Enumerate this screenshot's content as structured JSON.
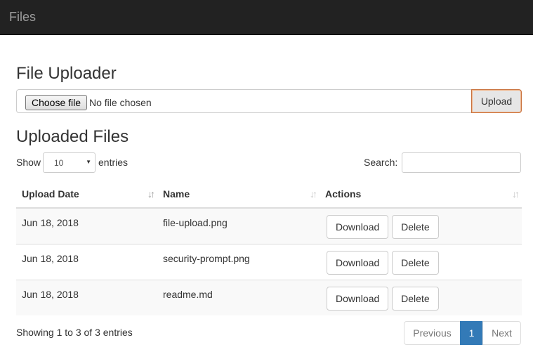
{
  "navbar": {
    "brand": "Files"
  },
  "uploader": {
    "title": "File Uploader",
    "choose_label": "Choose file",
    "status": "No file chosen",
    "upload_label": "Upload"
  },
  "files_section": {
    "title": "Uploaded Files"
  },
  "length": {
    "show_label": "Show",
    "selected": "10",
    "entries_label": "entries"
  },
  "search": {
    "label": "Search:",
    "value": ""
  },
  "table": {
    "columns": [
      "Upload Date",
      "Name",
      "Actions"
    ],
    "rows": [
      {
        "date": "Jun 18, 2018",
        "name": "file-upload.png",
        "download": "Download",
        "delete": "Delete"
      },
      {
        "date": "Jun 18, 2018",
        "name": "security-prompt.png",
        "download": "Download",
        "delete": "Delete"
      },
      {
        "date": "Jun 18, 2018",
        "name": "readme.md",
        "download": "Download",
        "delete": "Delete"
      }
    ]
  },
  "footer": {
    "summary": "Showing 1 to 3 of 3 entries",
    "previous": "Previous",
    "current_page": "1",
    "next": "Next"
  },
  "icons": {
    "sort_active": "sort-ascending-icon",
    "sort_inactive": "sort-both-icon",
    "select_caret": "caret-down-icon"
  },
  "colors": {
    "navbar": "#222222",
    "pager_active": "#337ab7",
    "upload_border": "#c9713b"
  }
}
